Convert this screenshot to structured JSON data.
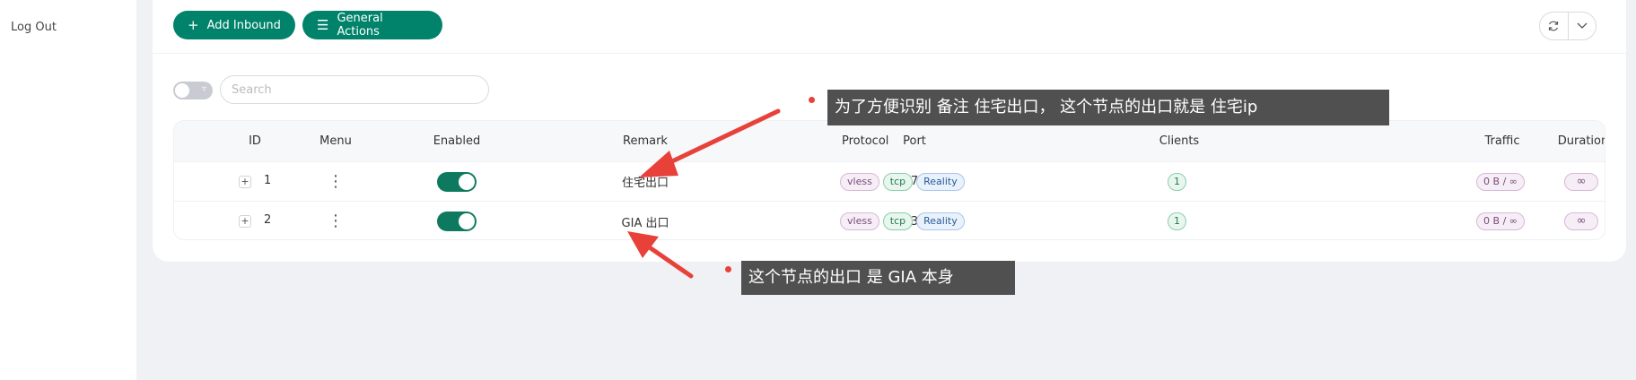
{
  "sidebar": {
    "logout_label": "Log Out"
  },
  "toolbar": {
    "add_inbound_label": "Add Inbound",
    "general_actions_label": "General Actions"
  },
  "search": {
    "placeholder": "Search"
  },
  "table": {
    "headers": {
      "id": "ID",
      "menu": "Menu",
      "enabled": "Enabled",
      "remark": "Remark",
      "port": "Port",
      "protocol": "Protocol",
      "clients": "Clients",
      "traffic": "Traffic",
      "duration": "Duration"
    },
    "rows": [
      {
        "id": "1",
        "enabled": true,
        "remark": "住宅出口",
        "port": "18719",
        "protocol_tags": [
          "vless",
          "tcp",
          "Reality"
        ],
        "clients": "1",
        "traffic": "0 B / ∞",
        "duration": "∞"
      },
      {
        "id": "2",
        "enabled": true,
        "remark": "GIA 出口",
        "port": "22333",
        "protocol_tags": [
          "vless",
          "tcp",
          "Reality"
        ],
        "clients": "1",
        "traffic": "0 B / ∞",
        "duration": "∞"
      }
    ]
  },
  "annotations": {
    "note1": "为了方便识别  备注 住宅出口， 这个节点的出口就是 住宅ip",
    "note2": "这个节点的出口 是 GIA 本身"
  },
  "colors": {
    "accent": "#00836a",
    "annotation_arrow": "#e8413a",
    "annotation_bg": "#505050"
  },
  "icons": {
    "add": "plus-icon",
    "general": "menu-icon",
    "refresh": "refresh-icon",
    "dropdown": "chevron-down-icon",
    "filter": "filter-icon",
    "row_menu": "more-vertical-icon",
    "expand": "plus-square-icon"
  }
}
